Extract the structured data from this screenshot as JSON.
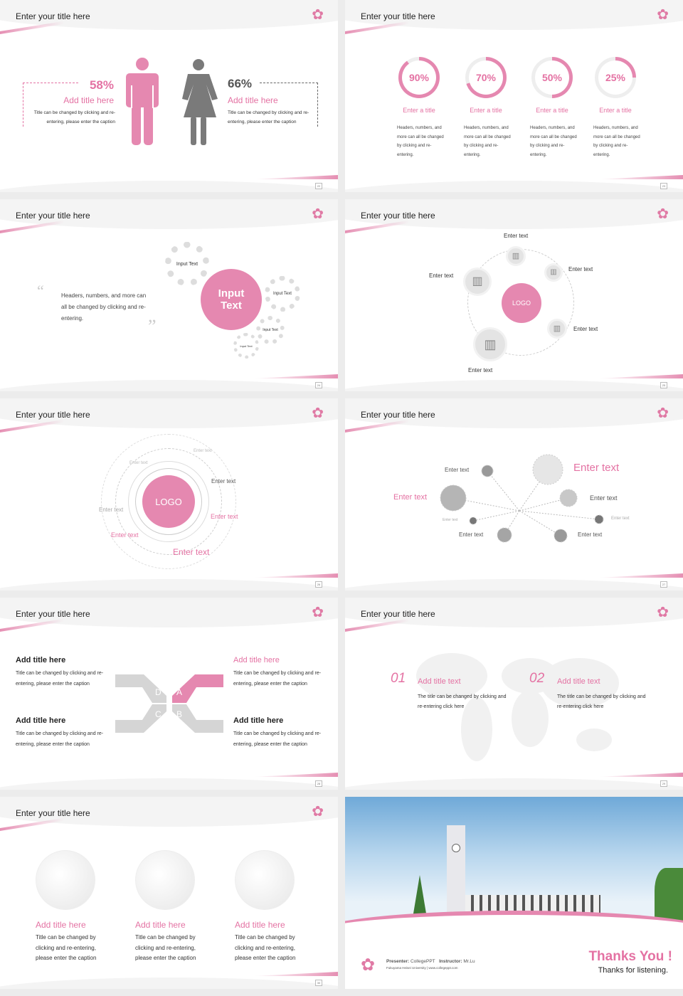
{
  "slide_title": "Enter your title here",
  "page_numbers": [
    "22",
    "23",
    "24",
    "25",
    "26",
    "27",
    "28",
    "29",
    "30"
  ],
  "accent": "#e472a3",
  "s1": {
    "left": {
      "pct": "58%",
      "title": "Add title here",
      "text": "Title can be changed by clicking and re-entering, please enter the caption"
    },
    "right": {
      "pct": "66%",
      "title": "Add title here",
      "text": "Title can be changed by clicking and re-entering, please enter the caption"
    },
    "icons": [
      "male-icon",
      "female-icon"
    ]
  },
  "s2": {
    "items": [
      {
        "pct": "90%",
        "value": 90,
        "title": "Enter a title",
        "text": "Headers, numbers, and more can all be changed by clicking and re-entering."
      },
      {
        "pct": "70%",
        "value": 70,
        "title": "Enter a title",
        "text": "Headers, numbers, and more can all be changed by clicking and re-entering."
      },
      {
        "pct": "50%",
        "value": 50,
        "title": "Enter a title",
        "text": "Headers, numbers, and more can all be changed by clicking and re-entering."
      },
      {
        "pct": "25%",
        "value": 25,
        "title": "Enter a title",
        "text": "Headers, numbers, and more can all be changed by clicking and re-entering."
      }
    ]
  },
  "s3": {
    "quote": "Headers, numbers, and more can all be changed by clicking and re-entering.",
    "main_gear": "Input Text",
    "gears": [
      "Input Text",
      "Input Text",
      "Input Text",
      "Input Text"
    ]
  },
  "s4": {
    "logo": "LOGO",
    "labels": [
      "Enter text",
      "Enter text",
      "Enter text",
      "Enter text",
      "Enter text"
    ]
  },
  "s5": {
    "logo": "LOGO",
    "labels": [
      "Enter text",
      "Enter text",
      "Enter text",
      "Enter text",
      "Enter text",
      "Enter text",
      "Enter text"
    ]
  },
  "s6": {
    "labels": [
      "Enter text",
      "Enter text",
      "Enter text",
      "Enter text",
      "Enter text",
      "Enter text",
      "Enter text",
      "Enter text"
    ]
  },
  "s7": {
    "letters": [
      "D",
      "A",
      "C",
      "B"
    ],
    "items": [
      {
        "title": "Add title here",
        "text": "Title can be changed by clicking and re-entering, please enter the caption"
      },
      {
        "title": "Add title here",
        "text": "Title can be changed by clicking and re-entering, please enter the caption"
      },
      {
        "title": "Add title here",
        "text": "Title can be changed by clicking and re-entering, please enter the caption"
      },
      {
        "title": "Add title here",
        "text": "Title can be changed by clicking and re-entering, please enter the caption"
      }
    ]
  },
  "s8": {
    "items": [
      {
        "num": "01",
        "title": "Add title text",
        "text": "The title can be changed by clicking and re-entering click here"
      },
      {
        "num": "02",
        "title": "Add title text",
        "text": "The title can be changed by clicking and re-entering click here"
      }
    ]
  },
  "s9": {
    "items": [
      {
        "title": "Add title here",
        "text": "Title can be changed by clicking and re-entering, please enter the caption"
      },
      {
        "title": "Add title here",
        "text": "Title can be changed by clicking and re-entering, please enter the caption"
      },
      {
        "title": "Add title here",
        "text": "Title can be changed by clicking and re-entering, please enter the caption"
      }
    ]
  },
  "s10": {
    "presenter_label": "Presenter:",
    "presenter": "CollegePPT",
    "instructor_label": "Instructor:",
    "instructor": "Mr.Lu",
    "university": "Fukuyama Heisei University  |  www.collegeppt.com",
    "thanks": "Thanks You !",
    "sub": "Thanks for listening."
  }
}
